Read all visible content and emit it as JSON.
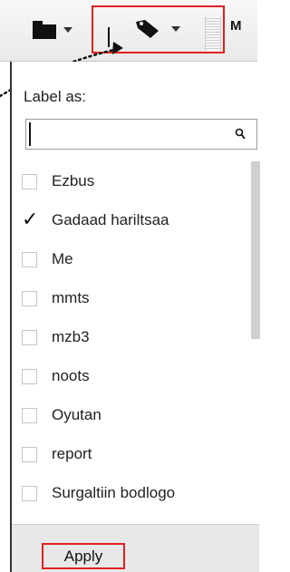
{
  "toolbar": {
    "folder_icon": "folder-icon",
    "label_icon": "tag-icon",
    "more_label": "M"
  },
  "panel": {
    "title": "Label as:",
    "search": {
      "value": "",
      "placeholder": ""
    },
    "labels": [
      {
        "name": "Ezbus",
        "checked": false
      },
      {
        "name": "Gadaad hariltsaa",
        "checked": true
      },
      {
        "name": "Me",
        "checked": false
      },
      {
        "name": "mmts",
        "checked": false
      },
      {
        "name": "mzb3",
        "checked": false
      },
      {
        "name": "noots",
        "checked": false
      },
      {
        "name": "Oyutan",
        "checked": false
      },
      {
        "name": "report",
        "checked": false
      },
      {
        "name": "Surgaltiin bodlogo",
        "checked": false
      }
    ],
    "apply_label": "Apply"
  },
  "colors": {
    "highlight": "#e2201f",
    "footer_bg": "#e8e8e8",
    "toolbar_bg": "#eeeeee"
  }
}
